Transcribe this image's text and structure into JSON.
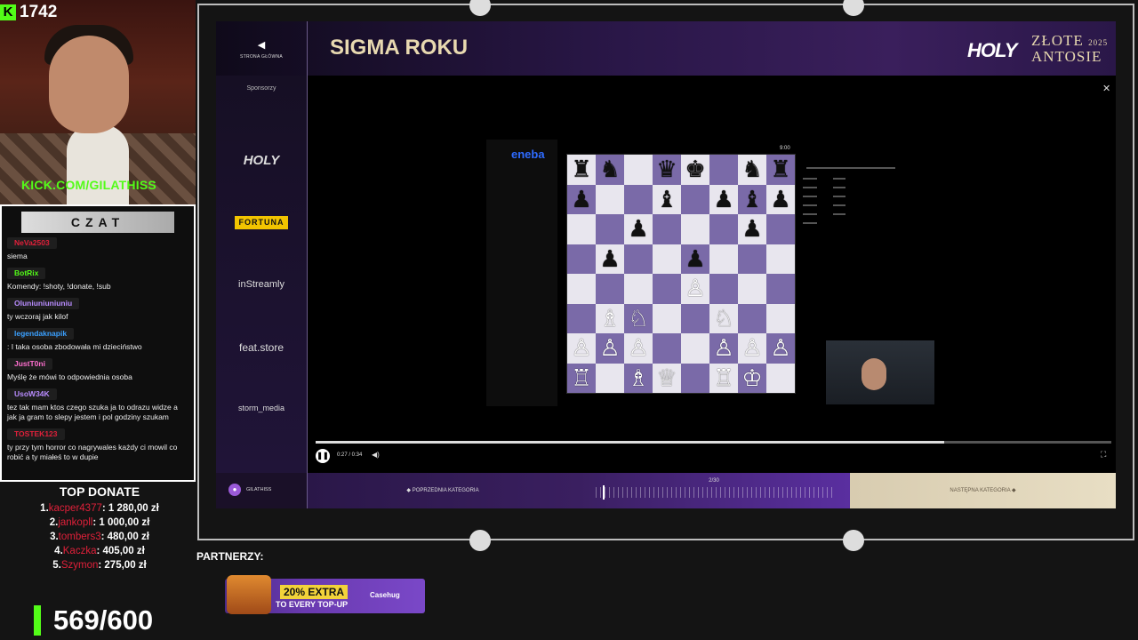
{
  "stream": {
    "viewer_count": "1742",
    "kick_handle": "KICK.COM/GILATHISS",
    "chat_title": "CZAT",
    "chat_messages": [
      {
        "user": "NeVa2503",
        "color": "#e0203a",
        "text": "siema"
      },
      {
        "user": "BotRix",
        "color": "#53fc18",
        "text": "Komendy: !shoty, !donate, !sub"
      },
      {
        "user": "Oluniuniuniuniu",
        "color": "#b98cff",
        "text": "ty wczoraj jak kilof"
      },
      {
        "user": "legendaknapik",
        "color": "#3aa0ff",
        "text": ": I taka osoba zbodowała mi dzieciństwo"
      },
      {
        "user": "JustT0ni",
        "color": "#ff6fcf",
        "text": "Myślę że mówi to odpowiednia osoba"
      },
      {
        "user": "UsoW34K",
        "color": "#b98cff",
        "text": "tez tak mam ktos czego szuka ja to odrazu widze a jak ja gram to slepy jestem i pol godziny szukam"
      },
      {
        "user": "TOSTEK123",
        "color": "#e0203a",
        "text": "ty przy tym horror co nagrywales każdy ci mowil co robić a ty miałeś to w dupie"
      }
    ],
    "top_donate": {
      "title": "TOP DONATE",
      "entries": [
        {
          "rank": "1.",
          "name": "kacper4377",
          "amount": ": 1 280,00 zł"
        },
        {
          "rank": "2.",
          "name": "jankopll",
          "amount": ": 1 000,00 zł"
        },
        {
          "rank": "3.",
          "name": "tombers3",
          "amount": ": 480,00 zł"
        },
        {
          "rank": "4.",
          "name": "Kaczka",
          "amount": ": 405,00 zł"
        },
        {
          "rank": "5.",
          "name": "Szymon",
          "amount": ": 275,00 zł"
        }
      ]
    },
    "goal": "569/600",
    "partners_label": "PARTNERZY:",
    "banner": {
      "pct": "20% EXTRA",
      "sub": "TO EVERY TOP-UP",
      "brand": "Casehug"
    }
  },
  "app": {
    "back_label": "STRONA GŁÓWNA",
    "title": "SIGMA ROKU",
    "logo_holy": "HOLY",
    "logo_zlote": "ZŁOTE",
    "logo_antosie": "ANTOSIE",
    "logo_year": "2025",
    "close_icon": "close-icon",
    "sponsors_label": "Sponsorzy",
    "sponsors": [
      "HOLY",
      "FORTUNA",
      "inStreamly",
      "feat.store",
      "storm_media"
    ],
    "video": {
      "time": "0:27 / 0:34",
      "progress": 0.79,
      "board_clock": "9:00",
      "eneba": "eneba"
    },
    "footer": {
      "username": "GILATHISS",
      "prev_label": "POPRZEDNIA KATEGORIA",
      "counter": "2/30",
      "next_label": "NASTĘPNA KATEGORIA"
    }
  }
}
